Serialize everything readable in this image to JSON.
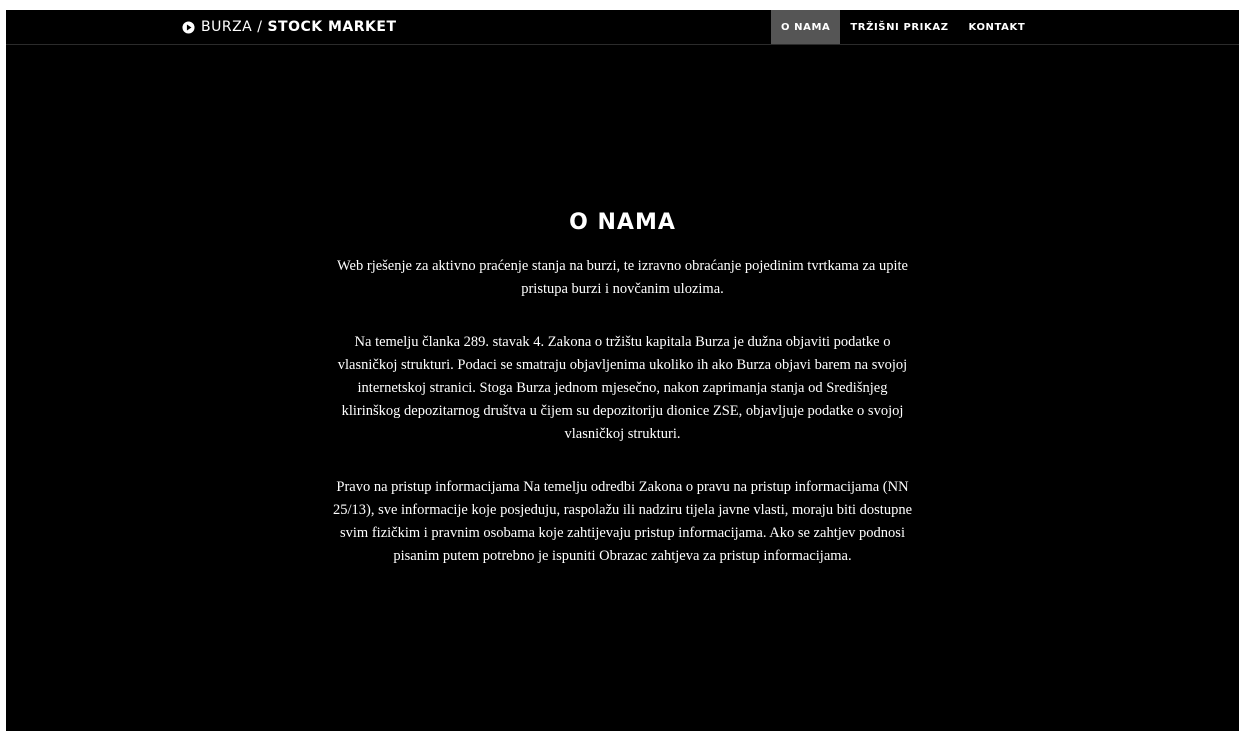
{
  "header": {
    "brand_part1": "BURZA",
    "brand_separator": "/",
    "brand_part2": "STOCK MARKET",
    "brand_icon": "play-circle-icon"
  },
  "nav": {
    "items": [
      {
        "label": "O NAMA",
        "active": true
      },
      {
        "label": "TRŽIŠNI PRIKAZ",
        "active": false
      },
      {
        "label": "KONTAKT",
        "active": false
      }
    ]
  },
  "main": {
    "title": "O NAMA",
    "paragraphs": [
      "Web rješenje za aktivno praćenje stanja na burzi, te izravno obraćanje pojedinim tvrtkama za upite pristupa burzi i novčanim ulozima.",
      "Na temelju članka 289. stavak 4. Zakona o tržištu kapitala Burza je dužna objaviti podatke o vlasničkoj strukturi. Podaci se smatraju objavljenima ukoliko ih ako Burza objavi barem na svojoj internetskoj stranici. Stoga Burza jednom mjesečno, nakon zaprimanja stanja od Središnjeg klirinškog depozitarnog društva u čijem su depozitoriju dionice ZSE, objavljuje podatke o svojoj vlasničkoj strukturi.",
      "Pravo na pristup informacijama Na temelju odredbi Zakona o pravu na pristup informacijama (NN 25/13), sve informacije koje posjeduju, raspolažu ili nadziru tijela javne vlasti, moraju biti dostupne svim fizičkim i pravnim osobama koje zahtijevaju pristup informacijama. Ako se zahtjev podnosi pisanim putem potrebno je ispuniti Obrazac zahtjeva za pristup informacijama."
    ]
  },
  "colors": {
    "background": "#000000",
    "text": "#ffffff",
    "nav_active": "#555555"
  }
}
